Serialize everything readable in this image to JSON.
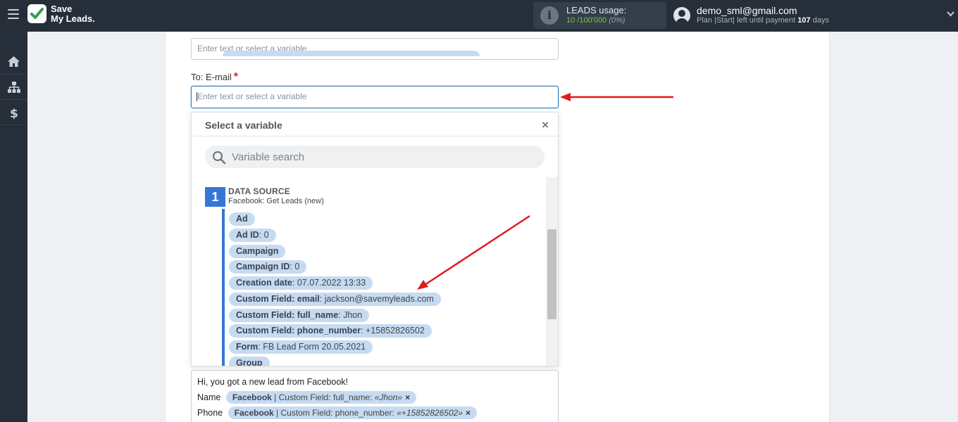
{
  "header": {
    "logo_line1": "Save",
    "logo_line2": "My Leads.",
    "usage_label": "LEADS usage:",
    "usage_used": "10",
    "usage_total": "/100'000",
    "usage_percent": "(0%)",
    "user_email": "demo_sml@gmail.com",
    "plan_prefix": "Plan |Start| left until payment",
    "plan_days": "107",
    "plan_suffix": "days"
  },
  "form": {
    "field1_placeholder": "Enter text or select a variable",
    "email_label": "To: E-mail",
    "required_mark": "*",
    "email_placeholder": "Enter text or select a variable"
  },
  "dropdown": {
    "title": "Select a variable",
    "close": "×",
    "search_placeholder": "Variable search",
    "source_number": "1",
    "source_title": "DATA SOURCE",
    "source_subtitle": "Facebook: Get Leads (new)",
    "variables": [
      {
        "name": "Ad",
        "value": ""
      },
      {
        "name": "Ad ID",
        "value": ": 0"
      },
      {
        "name": "Campaign",
        "value": ""
      },
      {
        "name": "Campaign ID",
        "value": ": 0"
      },
      {
        "name": "Creation date",
        "value": ": 07.07.2022 13:33"
      },
      {
        "name": "Custom Field: email",
        "value": ": jackson@savemyleads.com"
      },
      {
        "name": "Custom Field: full_name",
        "value": ": Jhon"
      },
      {
        "name": "Custom Field: phone_number",
        "value": ": +15852826502"
      },
      {
        "name": "Form",
        "value": ": FB Lead Form 20.05.2021"
      },
      {
        "name": "Group",
        "value": ""
      }
    ]
  },
  "message": {
    "line1": "Hi, you got a new lead from Facebook!",
    "row1_label": "Name",
    "row1_source": "Facebook",
    "row1_field": " | Custom Field: full_name: ",
    "row1_value": "«Jhon»",
    "row2_label": "Phone",
    "row2_source": "Facebook",
    "row2_field": " | Custom Field: phone_number: ",
    "row2_value": "«+15852826502»",
    "remove": "×"
  },
  "colors": {
    "topbar": "#252e39",
    "accent": "#3478d7",
    "tag": "#c6dbf2",
    "arrow": "#e01b1b",
    "usage_green": "#7fc241"
  },
  "icons": [
    "menu-icon",
    "logo-check-icon",
    "info-icon",
    "user-icon",
    "chevron-down-icon",
    "home-icon",
    "sitemap-icon",
    "dollar-icon",
    "close-icon",
    "search-icon"
  ]
}
